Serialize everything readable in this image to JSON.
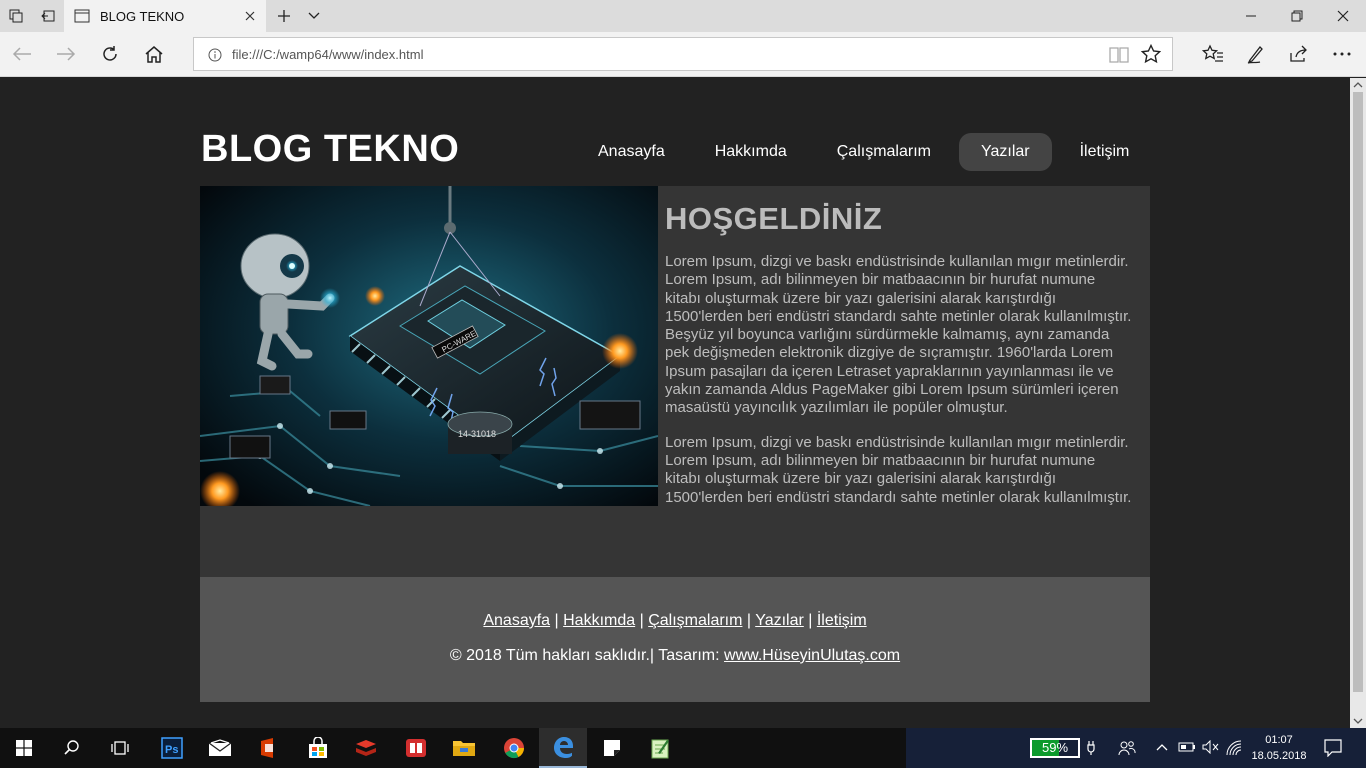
{
  "browser": {
    "tab_title": "BLOG TEKNO",
    "url": "file:///C:/wamp64/www/index.html"
  },
  "site": {
    "title": "BLOG TEKNO",
    "nav": [
      {
        "label": "Anasayfa",
        "active": false
      },
      {
        "label": "Hakkımda",
        "active": false
      },
      {
        "label": "Çalışmalarım",
        "active": false
      },
      {
        "label": "Yazılar",
        "active": true
      },
      {
        "label": "İletişim",
        "active": false
      }
    ],
    "hero_text": [
      "PC-WARE",
      "14-31018"
    ],
    "heading": "HOŞGELDİNİZ",
    "paragraphs": [
      "Lorem Ipsum, dizgi ve baskı endüstrisinde kullanılan mıgır metinlerdir. Lorem Ipsum, adı bilinmeyen bir matbaacının bir hurufat numune kitabı oluşturmak üzere bir yazı galerisini alarak karıştırdığı 1500'lerden beri endüstri standardı sahte metinler olarak kullanılmıştır. Beşyüz yıl boyunca varlığını sürdürmekle kalmamış, aynı zamanda pek değişmeden elektronik dizgiye de sıçramıştır. 1960'larda Lorem Ipsum pasajları da içeren Letraset yapraklarının yayınlanması ile ve yakın zamanda Aldus PageMaker gibi Lorem Ipsum sürümleri içeren masaüstü yayıncılık yazılımları ile popüler olmuştur.",
      "Lorem Ipsum, dizgi ve baskı endüstrisinde kullanılan mıgır metinlerdir. Lorem Ipsum, adı bilinmeyen bir matbaacının bir hurufat numune kitabı oluşturmak üzere bir yazı galerisini alarak karıştırdığı 1500'lerden beri endüstri standardı sahte metinler olarak kullanılmıştır."
    ],
    "footer": {
      "links": [
        "Anasayfa",
        "Hakkımda",
        "Çalışmalarım",
        "Yazılar",
        "İletişim"
      ],
      "separator": " | ",
      "copyright": "© 2018 Tüm hakları saklıdır.| Tasarım: ",
      "designer": "www.HüseyinUlutaş.com"
    }
  },
  "taskbar": {
    "battery_label": "59%",
    "battery_level": 0.59,
    "time": "01:07",
    "date": "18.05.2018",
    "apps": [
      "start-icon",
      "search-icon",
      "task-view-icon",
      "photoshop-icon",
      "mail-icon",
      "office-lens-icon",
      "store-icon",
      "redis-icon",
      "reader-icon",
      "file-explorer-icon",
      "chrome-icon",
      "edge-icon",
      "sticky-notes-icon",
      "notepad-icon"
    ]
  },
  "colors": {
    "page_bg": "#222222",
    "content_bg": "#353535",
    "footer_bg": "#555555",
    "nav_active_bg": "#444444",
    "battery_fill": "#0c9a2c"
  }
}
